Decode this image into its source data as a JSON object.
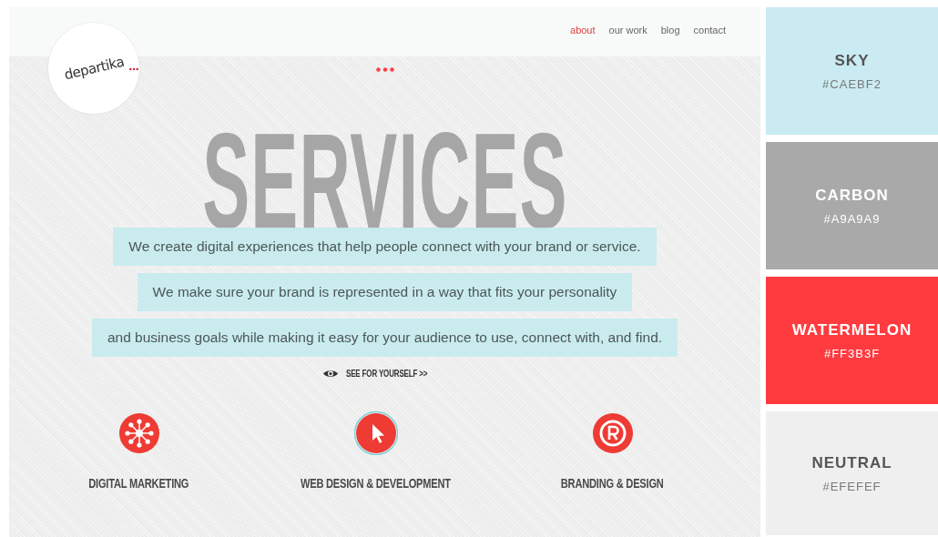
{
  "logo": "departika",
  "nav": [
    {
      "label": "about",
      "selected": true
    },
    {
      "label": "our work",
      "selected": false
    },
    {
      "label": "blog",
      "selected": false
    },
    {
      "label": "contact",
      "selected": false
    }
  ],
  "heading": "SERVICES",
  "intro_lines": [
    "We create digital experiences that help people connect with your brand or service.",
    "We make sure your brand is represented in a way that fits your personality",
    "and business goals while making it easy for your audience to use, connect with, and find."
  ],
  "cta": "SEE FOR YOURSELF >>",
  "services": [
    {
      "kind": "network",
      "label": "DIGITAL MARKETING",
      "selected": false
    },
    {
      "kind": "cursor",
      "label": "WEB DESIGN & DEVELOPMENT",
      "selected": true
    },
    {
      "kind": "registered",
      "label": "BRANDING & DESIGN",
      "selected": false
    }
  ],
  "swatches": [
    {
      "name": "SKY",
      "code": "#CAEBF2",
      "color": "#caebf2"
    },
    {
      "name": "CARBON",
      "code": "#A9A9A9",
      "color": "#a9a9a9"
    },
    {
      "name": "WATERMELON",
      "code": "#FF3B3F",
      "color": "#ff3b3f"
    },
    {
      "name": "NEUTRAL",
      "code": "#EFEFEF",
      "color": "#efefef"
    }
  ]
}
